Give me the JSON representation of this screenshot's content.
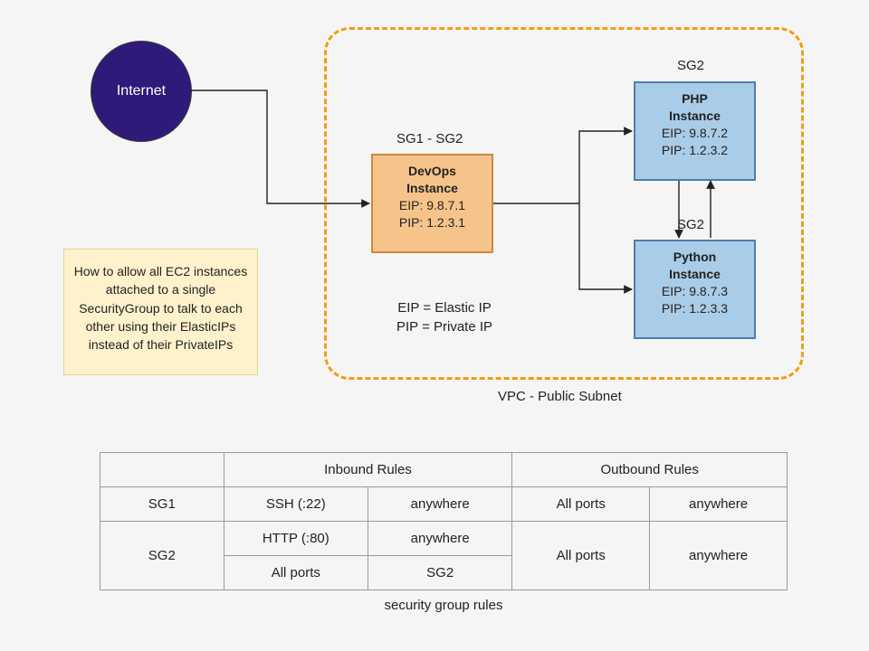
{
  "internet": {
    "label": "Internet"
  },
  "vpc": {
    "label": "VPC - Public Subnet"
  },
  "devops": {
    "sg_label": "SG1 - SG2",
    "title": "DevOps",
    "subtitle": "Instance",
    "eip": "EIP: 9.8.7.1",
    "pip": "PIP: 1.2.3.1"
  },
  "php": {
    "sg_label": "SG2",
    "title": "PHP",
    "subtitle": "Instance",
    "eip": "EIP: 9.8.7.2",
    "pip": "PIP: 1.2.3.2"
  },
  "python": {
    "sg_label": "SG2",
    "title": "Python",
    "subtitle": "Instance",
    "eip": "EIP: 9.8.7.3",
    "pip": "PIP: 1.2.3.3"
  },
  "ip_legend": {
    "line1": "EIP = Elastic IP",
    "line2": "PIP = Private IP"
  },
  "question": {
    "text": "How to allow all EC2 instances attached to a single SecurityGroup to talk to each other using their ElasticIPs instead of their PrivateIPs"
  },
  "table": {
    "header_inbound": "Inbound Rules",
    "header_outbound": "Outbound Rules",
    "sg1_label": "SG1",
    "sg2_label": "SG2",
    "sg1_in_proto": "SSH (:22)",
    "sg1_in_src": "anywhere",
    "sg1_out_proto": "All ports",
    "sg1_out_dst": "anywhere",
    "sg2_in1_proto": "HTTP (:80)",
    "sg2_in1_src": "anywhere",
    "sg2_in2_proto": "All ports",
    "sg2_in2_src": "SG2",
    "sg2_out_proto": "All ports",
    "sg2_out_dst": "anywhere",
    "caption": "security group rules"
  }
}
